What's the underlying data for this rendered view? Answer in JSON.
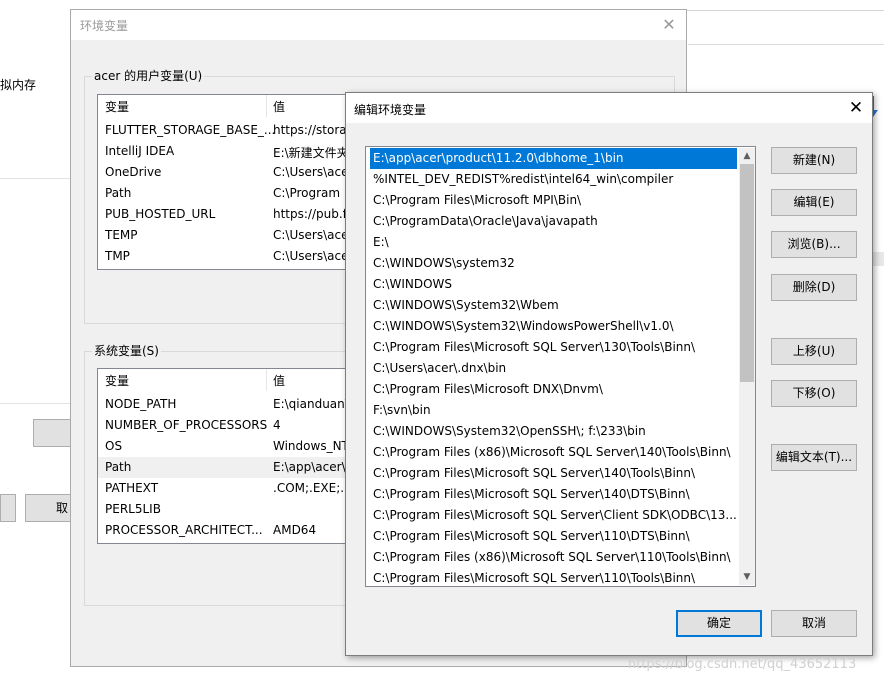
{
  "background": {
    "memory_text": "拟内存",
    "cancel_label": "取"
  },
  "env_dialog": {
    "title": "环境变量",
    "close_glyph": "✕",
    "user_group_label": "acer 的用户变量(U)",
    "system_group_label": "系统变量(S)",
    "columns": [
      "变量",
      "值"
    ],
    "user_vars": [
      {
        "name": "FLUTTER_STORAGE_BASE_...",
        "value": "https://storag"
      },
      {
        "name": "IntelliJ IDEA",
        "value": "E:\\新建文件夹"
      },
      {
        "name": "OneDrive",
        "value": "C:\\Users\\ace"
      },
      {
        "name": "Path",
        "value": "C:\\Program F"
      },
      {
        "name": "PUB_HOSTED_URL",
        "value": "https://pub.fl"
      },
      {
        "name": "TEMP",
        "value": "C:\\Users\\ace"
      },
      {
        "name": "TMP",
        "value": "C:\\Users\\ace"
      }
    ],
    "system_vars": [
      {
        "name": "NODE_PATH",
        "value": "E:\\qianduan\\"
      },
      {
        "name": "NUMBER_OF_PROCESSORS",
        "value": "4"
      },
      {
        "name": "OS",
        "value": "Windows_NT"
      },
      {
        "name": "Path",
        "value": "E:\\app\\acer\\"
      },
      {
        "name": "PATHEXT",
        "value": ".COM;.EXE;.B"
      },
      {
        "name": "PERL5LIB",
        "value": ""
      },
      {
        "name": "PROCESSOR_ARCHITECT...",
        "value": "AMD64"
      }
    ]
  },
  "edit_dialog": {
    "title": "编辑环境变量",
    "close_glyph": "✕",
    "paths": [
      "E:\\app\\acer\\product\\11.2.0\\dbhome_1\\bin",
      "%INTEL_DEV_REDIST%redist\\intel64_win\\compiler",
      "C:\\Program Files\\Microsoft MPI\\Bin\\",
      "C:\\ProgramData\\Oracle\\Java\\javapath",
      "E:\\",
      "C:\\WINDOWS\\system32",
      "C:\\WINDOWS",
      "C:\\WINDOWS\\System32\\Wbem",
      "C:\\WINDOWS\\System32\\WindowsPowerShell\\v1.0\\",
      "C:\\Program Files\\Microsoft SQL Server\\130\\Tools\\Binn\\",
      "C:\\Users\\acer\\.dnx\\bin",
      "C:\\Program Files\\Microsoft DNX\\Dnvm\\",
      "F:\\svn\\bin",
      "C:\\WINDOWS\\System32\\OpenSSH\\;   f:\\233\\bin",
      "C:\\Program Files (x86)\\Microsoft SQL Server\\140\\Tools\\Binn\\",
      "C:\\Program Files\\Microsoft SQL Server\\140\\Tools\\Binn\\",
      "C:\\Program Files\\Microsoft SQL Server\\140\\DTS\\Binn\\",
      "C:\\Program Files\\Microsoft SQL Server\\Client SDK\\ODBC\\13...",
      "C:\\Program Files\\Microsoft SQL Server\\110\\DTS\\Binn\\",
      "C:\\Program Files (x86)\\Microsoft SQL Server\\110\\Tools\\Binn\\",
      "C:\\Program Files\\Microsoft SQL Server\\110\\Tools\\Binn\\"
    ],
    "scroll_up_glyph": "▲",
    "scroll_down_glyph": "▼",
    "buttons": {
      "new": "新建(N)",
      "edit": "编辑(E)",
      "browse": "浏览(B)...",
      "delete": "删除(D)",
      "move_up": "上移(U)",
      "move_down": "下移(O)",
      "edit_text": "编辑文本(T)...",
      "ok": "确定",
      "cancel": "取消"
    }
  },
  "watermark": "https://blog.csdn.net/qq_43652113",
  "colors": {
    "selection": "#0078d7",
    "dialog_bg": "#f0f0f0",
    "button_bg": "#e1e1e1"
  }
}
